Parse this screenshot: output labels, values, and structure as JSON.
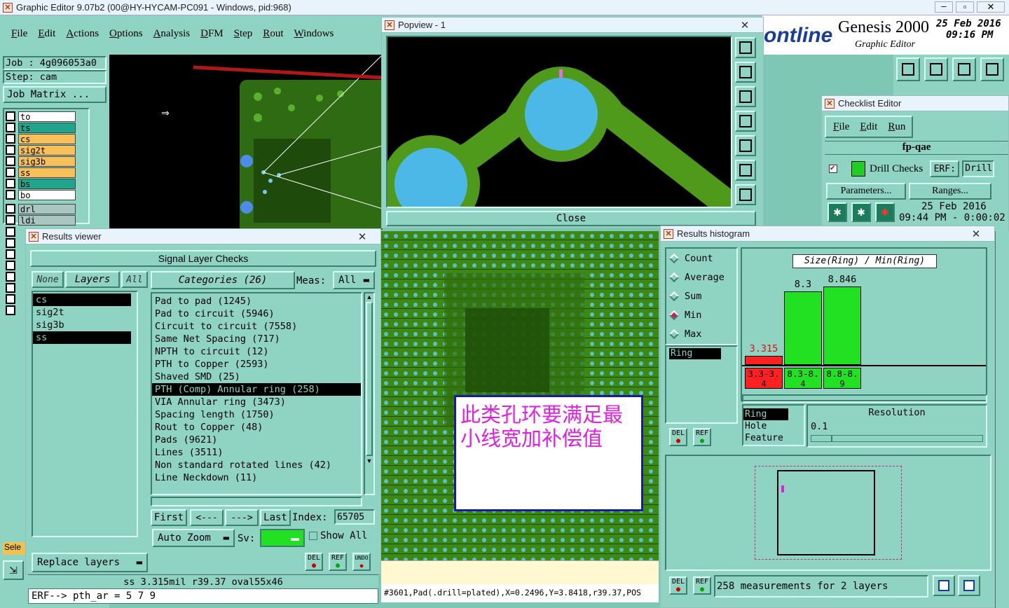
{
  "main_window": {
    "title": "Graphic Editor 9.07b2 (00@HY-HYCAM-PC091 - Windows, pid:968)",
    "menu": [
      "File",
      "Edit",
      "Actions",
      "Options",
      "Analysis",
      "DFM",
      "Step",
      "Rout",
      "Windows"
    ],
    "job_label": "Job : 4g096053a0",
    "step_label": "Step: cam",
    "job_matrix": "Job Matrix ...",
    "brand_partial": "ontline",
    "product": "Genesis 2000",
    "subtitle": "Graphic Editor",
    "date": "25 Feb 2016",
    "time": "09:16 PM",
    "sele_label": "Sele",
    "erf_line": "ERF--> pth_ar = 5 7 9",
    "status_info": "ss 3.315mil  r39.37  oval55x46",
    "coord_status": "#3601,Pad(.drill=plated),X=0.2496,Y=3.8418,r39.37,POS"
  },
  "layers": [
    {
      "name": "to",
      "color": "#ffffff"
    },
    {
      "name": "ts",
      "color": "#1fa58b"
    },
    {
      "name": "cs",
      "color": "#f7c05a"
    },
    {
      "name": "sig2t",
      "color": "#f7c05a"
    },
    {
      "name": "sig3b",
      "color": "#f7c05a"
    },
    {
      "name": "ss",
      "color": "#f7c05a"
    },
    {
      "name": "bs",
      "color": "#1fa58b"
    },
    {
      "name": "bo",
      "color": "#ffffff"
    },
    {
      "name": "drl",
      "color": "#a9c7c0"
    },
    {
      "name": "ldi",
      "color": "#a9c7c0"
    }
  ],
  "popview": {
    "title": "Popview - 1",
    "close_label": "Close"
  },
  "results_viewer": {
    "title": "Results viewer",
    "header": "Signal Layer Checks",
    "none_btn": "None",
    "layers_btn": "Layers",
    "all_btn": "All",
    "layer_list": [
      "cs",
      "sig2t",
      "sig3b",
      "ss"
    ],
    "categories_label": "Categories (26)",
    "meas_label": "Meas:",
    "meas_value": "All",
    "categories": [
      "Pad to pad (1245)",
      "Pad to circuit (5946)",
      "Circuit to circuit (7558)",
      "Same Net Spacing (717)",
      "NPTH to circuit (12)",
      "PTH to Copper (2593)",
      "Shaved SMD (25)",
      "PTH (Comp) Annular ring (258)",
      "VIA Annular ring (3473)",
      "Spacing length (1750)",
      "Rout to Copper (48)",
      "Pads (9621)",
      "Lines (3511)",
      "Non standard rotated lines (42)",
      "Line Neckdown (11)"
    ],
    "selected_category": 7,
    "first_btn": "First",
    "prev_btn": "<---",
    "next_btn": "--->",
    "last_btn": "Last",
    "index_label": "Index:",
    "index_value": "65705",
    "auto_zoom": "Auto Zoom",
    "sv_label": "Sv:",
    "show_all": "Show All",
    "replace_layers": "Replace layers",
    "del_btn": "DEL",
    "ref_btn": "REF",
    "undo_btn": "UNDO"
  },
  "checklist_editor": {
    "title": "Checklist Editor",
    "menu": [
      "File",
      "Edit",
      "Run"
    ],
    "name": "fp-qae",
    "check_name": "Drill Checks",
    "erf_label": "ERF:",
    "erf_value": "Drill",
    "parameters_btn": "Parameters...",
    "ranges_btn": "Ranges...",
    "date": "25 Feb 2016",
    "time": "09:44 PM - 0:00:02"
  },
  "histogram": {
    "title": "Results histogram",
    "options": [
      "Count",
      "Average",
      "Sum",
      "Min",
      "Max"
    ],
    "selected_option": "Min",
    "list_item": "Ring",
    "chart_title": "Size(Ring) / Min(Ring)",
    "bars": [
      {
        "value": "3.315",
        "range": "3.3-3.4",
        "color": "#ff2020"
      },
      {
        "value": "8.3",
        "range": "8.3-8.4",
        "color": "#22e022"
      },
      {
        "value": "8.846",
        "range": "8.8-8.9",
        "color": "#22e022"
      }
    ],
    "measure_list": [
      "Ring",
      "Hole",
      "Feature"
    ],
    "resolution_label": "Resolution",
    "resolution_value": "0.1",
    "summary": "258 measurements for 2 layers",
    "del_btn": "DEL",
    "ref_btn": "REF"
  },
  "annotation": {
    "text": "此类孔环要满足最小线宽加补偿值"
  },
  "colors": {
    "pcb_green": "#4f9a1a",
    "pad_cyan": "#4cb8e8",
    "annotation_magenta": "#e020e0"
  }
}
